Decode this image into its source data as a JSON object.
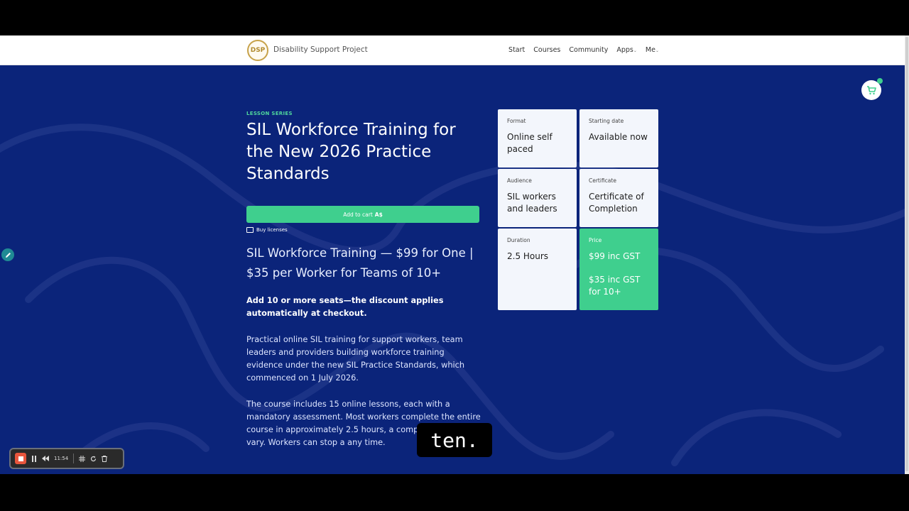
{
  "header": {
    "logo_text": "DSP",
    "brand": "Disability Support Project",
    "nav": [
      "Start",
      "Courses",
      "Community",
      "Apps",
      "Me"
    ]
  },
  "course": {
    "eyebrow": "LESSON SERIES",
    "title": "SIL Workforce Training for the New 2026 Practice Standards",
    "add_to_cart_label": "Add to cart",
    "add_to_cart_price": "A$",
    "buy_licenses": "Buy licenses",
    "subtitle": "SIL Workforce Training — $99 for One | $35 per Worker for Teams of 10+",
    "bold_paragraph": "Add 10 or more seats—the discount applies automatically at checkout.",
    "paragraph1": "Practical online SIL training for support workers, team leaders and providers building workforce training evidence under the new SIL Practice Standards, which commenced on 1 July 2026.",
    "paragraph2": "The course includes 15 online lessons, each with a mandatory assessment. Most workers complete the entire course in approximately 2.5 hours, a completion times vary. Workers can stop a any time."
  },
  "cards": {
    "format": {
      "label": "Format",
      "value": "Online self paced"
    },
    "starting_date": {
      "label": "Starting date",
      "value": "Available now"
    },
    "audience": {
      "label": "Audience",
      "value": "SIL workers and leaders"
    },
    "certificate": {
      "label": "Certificate",
      "value": "Certificate of Completion"
    },
    "duration": {
      "label": "Duration",
      "value": "2.5 Hours"
    },
    "price": {
      "label": "Price",
      "value": "$99 inc GST",
      "value2": "$35 inc GST for 10+"
    }
  },
  "recorder": {
    "time": "11:54"
  },
  "caption": "ten.",
  "colors": {
    "page_bg": "#0b247a",
    "accent_green": "#3fcf8e",
    "card_bg": "#f3f6fc",
    "record_red": "#e8553c"
  },
  "icons": [
    "cart-icon",
    "pencil-icon",
    "stop-icon",
    "pause-icon",
    "rewind-icon",
    "grid-icon",
    "restart-icon",
    "trash-icon",
    "licenses-icon"
  ]
}
